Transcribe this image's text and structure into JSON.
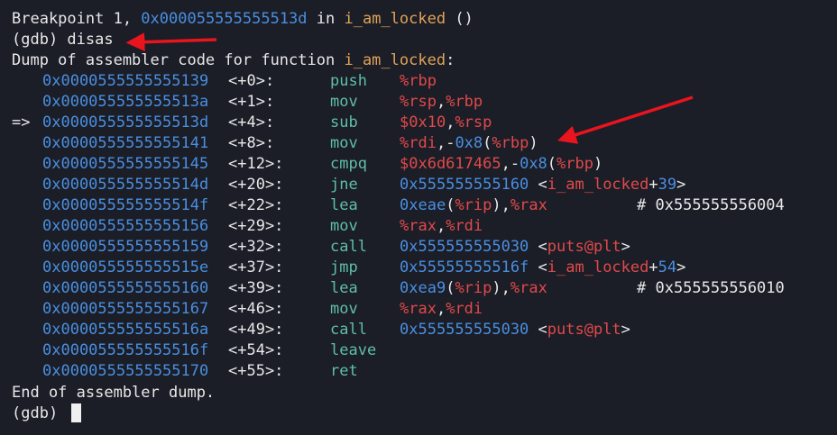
{
  "terminal": {
    "breakpoint": {
      "prefix": "Breakpoint 1, ",
      "address": "0x000055555555513d",
      "mid": " in ",
      "func": "i_am_locked",
      "suffix": " ()"
    },
    "command": "(gdb) disas",
    "dump_header_prefix": "Dump of assembler code for function ",
    "dump_header_func": "i_am_locked",
    "dump_header_suffix": ":",
    "rows": [
      {
        "arrow": "",
        "addr": "0x0000555555555139",
        "off": "<+0>:",
        "mnem": "push",
        "ops": [
          {
            "t": "%rbp",
            "c": "reg"
          }
        ],
        "comment": ""
      },
      {
        "arrow": "",
        "addr": "0x000055555555513a",
        "off": "<+1>:",
        "mnem": "mov",
        "ops": [
          {
            "t": "%rsp",
            "c": "reg"
          },
          {
            "t": ",",
            "c": "text"
          },
          {
            "t": "%rbp",
            "c": "reg"
          }
        ],
        "comment": ""
      },
      {
        "arrow": "=>",
        "addr": "0x000055555555513d",
        "off": "<+4>:",
        "mnem": "sub",
        "ops": [
          {
            "t": "$0x10",
            "c": "reg"
          },
          {
            "t": ",",
            "c": "text"
          },
          {
            "t": "%rsp",
            "c": "reg"
          }
        ],
        "comment": ""
      },
      {
        "arrow": "",
        "addr": "0x0000555555555141",
        "off": "<+8>:",
        "mnem": "mov",
        "ops": [
          {
            "t": "%rdi",
            "c": "reg"
          },
          {
            "t": ",-",
            "c": "text"
          },
          {
            "t": "0x8",
            "c": "addr"
          },
          {
            "t": "(",
            "c": "text"
          },
          {
            "t": "%rbp",
            "c": "reg"
          },
          {
            "t": ")",
            "c": "text"
          }
        ],
        "comment": ""
      },
      {
        "arrow": "",
        "addr": "0x0000555555555145",
        "off": "<+12>:",
        "mnem": "cmpq",
        "ops": [
          {
            "t": "$0x6d617465",
            "c": "reg"
          },
          {
            "t": ",-",
            "c": "text"
          },
          {
            "t": "0x8",
            "c": "addr"
          },
          {
            "t": "(",
            "c": "text"
          },
          {
            "t": "%rbp",
            "c": "reg"
          },
          {
            "t": ")",
            "c": "text"
          }
        ],
        "comment": ""
      },
      {
        "arrow": "",
        "addr": "0x000055555555514d",
        "off": "<+20>:",
        "mnem": "jne",
        "ops": [
          {
            "t": "0x555555555160",
            "c": "addr"
          },
          {
            "t": " <",
            "c": "text"
          },
          {
            "t": "i_am_locked",
            "c": "reg"
          },
          {
            "t": "+",
            "c": "text"
          },
          {
            "t": "39",
            "c": "addr"
          },
          {
            "t": ">",
            "c": "text"
          }
        ],
        "comment": ""
      },
      {
        "arrow": "",
        "addr": "0x000055555555514f",
        "off": "<+22>:",
        "mnem": "lea",
        "ops": [
          {
            "t": "0xeae",
            "c": "addr"
          },
          {
            "t": "(",
            "c": "text"
          },
          {
            "t": "%rip",
            "c": "reg"
          },
          {
            "t": "),",
            "c": "text"
          },
          {
            "t": "%rax",
            "c": "reg"
          }
        ],
        "comment": "# 0x555555556004"
      },
      {
        "arrow": "",
        "addr": "0x0000555555555156",
        "off": "<+29>:",
        "mnem": "mov",
        "ops": [
          {
            "t": "%rax",
            "c": "reg"
          },
          {
            "t": ",",
            "c": "text"
          },
          {
            "t": "%rdi",
            "c": "reg"
          }
        ],
        "comment": ""
      },
      {
        "arrow": "",
        "addr": "0x0000555555555159",
        "off": "<+32>:",
        "mnem": "call",
        "ops": [
          {
            "t": "0x555555555030",
            "c": "addr"
          },
          {
            "t": " <",
            "c": "text"
          },
          {
            "t": "puts@plt",
            "c": "reg"
          },
          {
            "t": ">",
            "c": "text"
          }
        ],
        "comment": ""
      },
      {
        "arrow": "",
        "addr": "0x000055555555515e",
        "off": "<+37>:",
        "mnem": "jmp",
        "ops": [
          {
            "t": "0x55555555516f",
            "c": "addr"
          },
          {
            "t": " <",
            "c": "text"
          },
          {
            "t": "i_am_locked",
            "c": "reg"
          },
          {
            "t": "+",
            "c": "text"
          },
          {
            "t": "54",
            "c": "addr"
          },
          {
            "t": ">",
            "c": "text"
          }
        ],
        "comment": ""
      },
      {
        "arrow": "",
        "addr": "0x0000555555555160",
        "off": "<+39>:",
        "mnem": "lea",
        "ops": [
          {
            "t": "0xea9",
            "c": "addr"
          },
          {
            "t": "(",
            "c": "text"
          },
          {
            "t": "%rip",
            "c": "reg"
          },
          {
            "t": "),",
            "c": "text"
          },
          {
            "t": "%rax",
            "c": "reg"
          }
        ],
        "comment": "# 0x555555556010"
      },
      {
        "arrow": "",
        "addr": "0x0000555555555167",
        "off": "<+46>:",
        "mnem": "mov",
        "ops": [
          {
            "t": "%rax",
            "c": "reg"
          },
          {
            "t": ",",
            "c": "text"
          },
          {
            "t": "%rdi",
            "c": "reg"
          }
        ],
        "comment": ""
      },
      {
        "arrow": "",
        "addr": "0x000055555555516a",
        "off": "<+49>:",
        "mnem": "call",
        "ops": [
          {
            "t": "0x555555555030",
            "c": "addr"
          },
          {
            "t": " <",
            "c": "text"
          },
          {
            "t": "puts@plt",
            "c": "reg"
          },
          {
            "t": ">",
            "c": "text"
          }
        ],
        "comment": ""
      },
      {
        "arrow": "",
        "addr": "0x000055555555516f",
        "off": "<+54>:",
        "mnem": "leave",
        "ops": [],
        "comment": ""
      },
      {
        "arrow": "",
        "addr": "0x0000555555555170",
        "off": "<+55>:",
        "mnem": "ret",
        "ops": [],
        "comment": ""
      }
    ],
    "dump_footer": "End of assembler dump.",
    "prompt": "(gdb) "
  },
  "colors": {
    "background": "#1b1d27",
    "text": "#e8e8e8",
    "address": "#4a8fe0",
    "function": "#e0a458",
    "register": "#e04a4a",
    "instruction": "#5fbfa8",
    "annotation_arrow": "#e8141e"
  }
}
